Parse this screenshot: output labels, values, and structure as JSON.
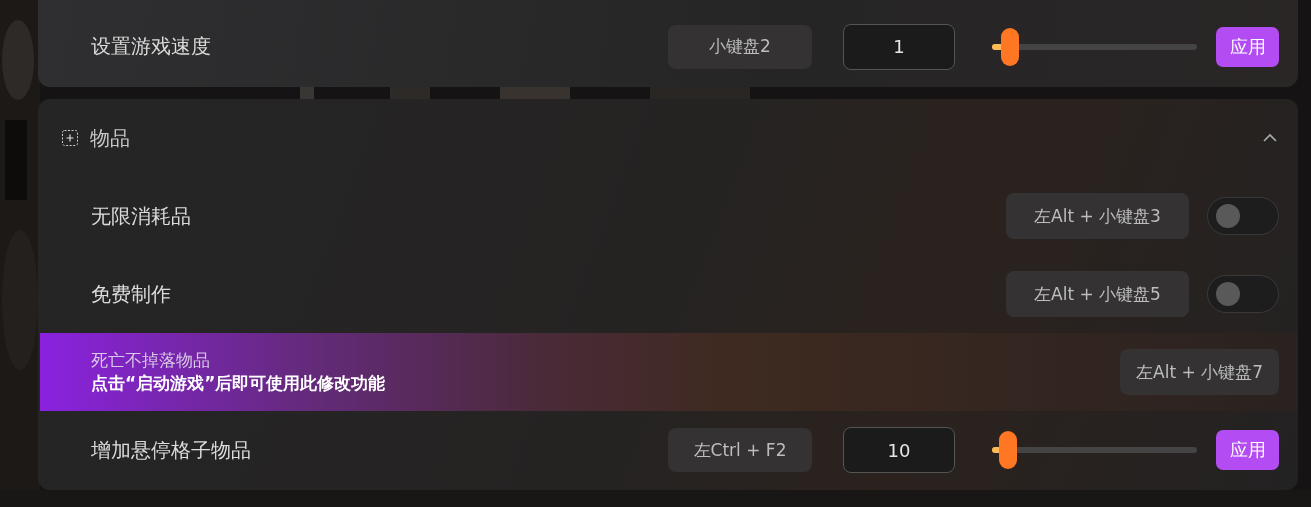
{
  "top_card": {
    "rows": [
      {
        "kind": "slider",
        "label": "设置游戏速度",
        "hotkey": "小键盘2",
        "value": "1",
        "level": 0.09,
        "button": "应用"
      }
    ]
  },
  "section": {
    "title": "物品",
    "expanded": true,
    "rows": [
      {
        "kind": "toggle",
        "label": "无限消耗品",
        "hotkey": "左Alt + 小键盘3",
        "on": false
      },
      {
        "kind": "toggle",
        "label": "免费制作",
        "hotkey": "左Alt + 小键盘5",
        "on": false
      },
      {
        "kind": "locked",
        "label": "死亡不掉落物品",
        "notice": "点击“启动游戏”后即可使用此修改功能",
        "hotkey": "左Alt + 小键盘7"
      },
      {
        "kind": "slider",
        "label": "增加悬停格子物品",
        "hotkey": "左Ctrl + F2",
        "value": "10",
        "level": 0.08,
        "button": "应用"
      }
    ]
  }
}
